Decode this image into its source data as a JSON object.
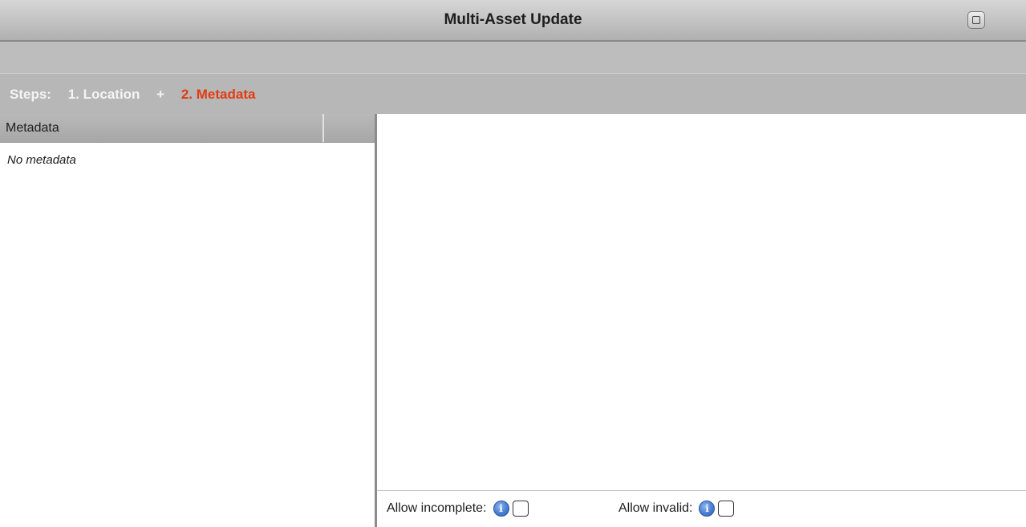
{
  "window": {
    "title": "Multi-Asset Update",
    "maximize_icon": "maximize-icon"
  },
  "steps": {
    "label": "Steps:",
    "items": [
      {
        "label": "1. Location",
        "state": "completed",
        "color": "#f4f4f4"
      },
      {
        "label": "2. Metadata",
        "state": "current",
        "color": "#e23b12"
      }
    ],
    "separator": "+"
  },
  "metadata_panel": {
    "column_header": "Metadata",
    "empty_text": "No metadata"
  },
  "options": {
    "allow_incomplete": {
      "label": "Allow incomplete:",
      "info_icon": "info-icon",
      "checked": false
    },
    "allow_invalid": {
      "label": "Allow invalid:",
      "info_icon": "info-icon",
      "checked": false
    }
  },
  "colors": {
    "accent": "#e23b12",
    "info": "#4a7fd3"
  }
}
